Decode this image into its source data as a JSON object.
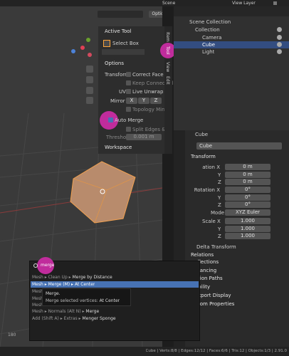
{
  "topbar": {
    "scene": "Scene",
    "view_layer": "View Layer"
  },
  "viewport": {
    "options_label": "Options",
    "ruler_number": "180"
  },
  "active_tool": {
    "header": "Active Tool",
    "tool_name": "Select Box"
  },
  "tool_options": {
    "header": "Options",
    "transform_label": "Transform",
    "correct_face": "Correct Face Att...",
    "keep_connected": "Keep Connected",
    "uvs_label": "UVs",
    "live_unwrap": "Live Unwrap",
    "mirror_label": "Mirror",
    "axes": [
      "X",
      "Y",
      "Z"
    ],
    "topology_mirror": "Topology Mirror",
    "auto_merge": "Auto Merge",
    "split_edges": "Split Edges & Fa...",
    "threshold_label": "Threshold",
    "threshold_value": "0.001 m",
    "workspace": "Workspace"
  },
  "sidebar_tabs": [
    "Item",
    "Tool",
    "View",
    "Edit"
  ],
  "outliner": {
    "items": [
      {
        "label": "Scene Collection"
      },
      {
        "label": "Collection"
      },
      {
        "label": "Camera"
      },
      {
        "label": "Cube"
      },
      {
        "label": "Light"
      }
    ]
  },
  "properties": {
    "header_object": "Cube",
    "object_name": "Cube",
    "transform_header": "Transform",
    "location_label": "Location X",
    "rotation_label": "Rotation X",
    "scale_label": "Scale X",
    "axis_y": "Y",
    "axis_z": "Z",
    "location": [
      "0 m",
      "0 m",
      "0 m"
    ],
    "rotation": [
      "0°",
      "0°",
      "0°"
    ],
    "mode_label": "Mode",
    "mode_value": "XYZ Euler",
    "scale": [
      "1.000",
      "1.000",
      "1.000"
    ],
    "delta_transform": "Delta Transform",
    "relations": "Relations",
    "collections": "llections",
    "instancing": "tancing",
    "motion_paths": "tion Paths",
    "visibility": "bility",
    "viewport_display": "xport Display",
    "custom_properties": "tom Properties"
  },
  "search_menu": {
    "query": "merge",
    "results": [
      {
        "prefix": "Mesh ▸ Clean Up ▸ ",
        "label": "Merge by Distance"
      },
      {
        "prefix": "Mesh ▸ Merge (M) ▸ ",
        "label": "At Center"
      },
      {
        "prefix": "Mesh",
        "label": ""
      },
      {
        "prefix": "Mesh",
        "label": ""
      },
      {
        "prefix": "Mesh",
        "label": ""
      },
      {
        "prefix": "Mesh ▸ Normals (Alt N) ▸ ",
        "label": "Merge"
      },
      {
        "prefix": "Add (Shift A) ▸ Extras ▸ ",
        "label": "Menger Sponge"
      }
    ],
    "tooltip_title": "Merge.",
    "tooltip_desc": "Merge selected vertices:",
    "tooltip_value": "At Center"
  },
  "statusbar": {
    "text": "Cube | Verts:8/8 | Edges:12/12 | Faces:6/6 | Tris:12 | Objects:1/3 | 2.91.0"
  },
  "colors": {
    "accent": "#c02c9c",
    "select_blue": "#4772b3",
    "cube": "#b88b6c"
  }
}
